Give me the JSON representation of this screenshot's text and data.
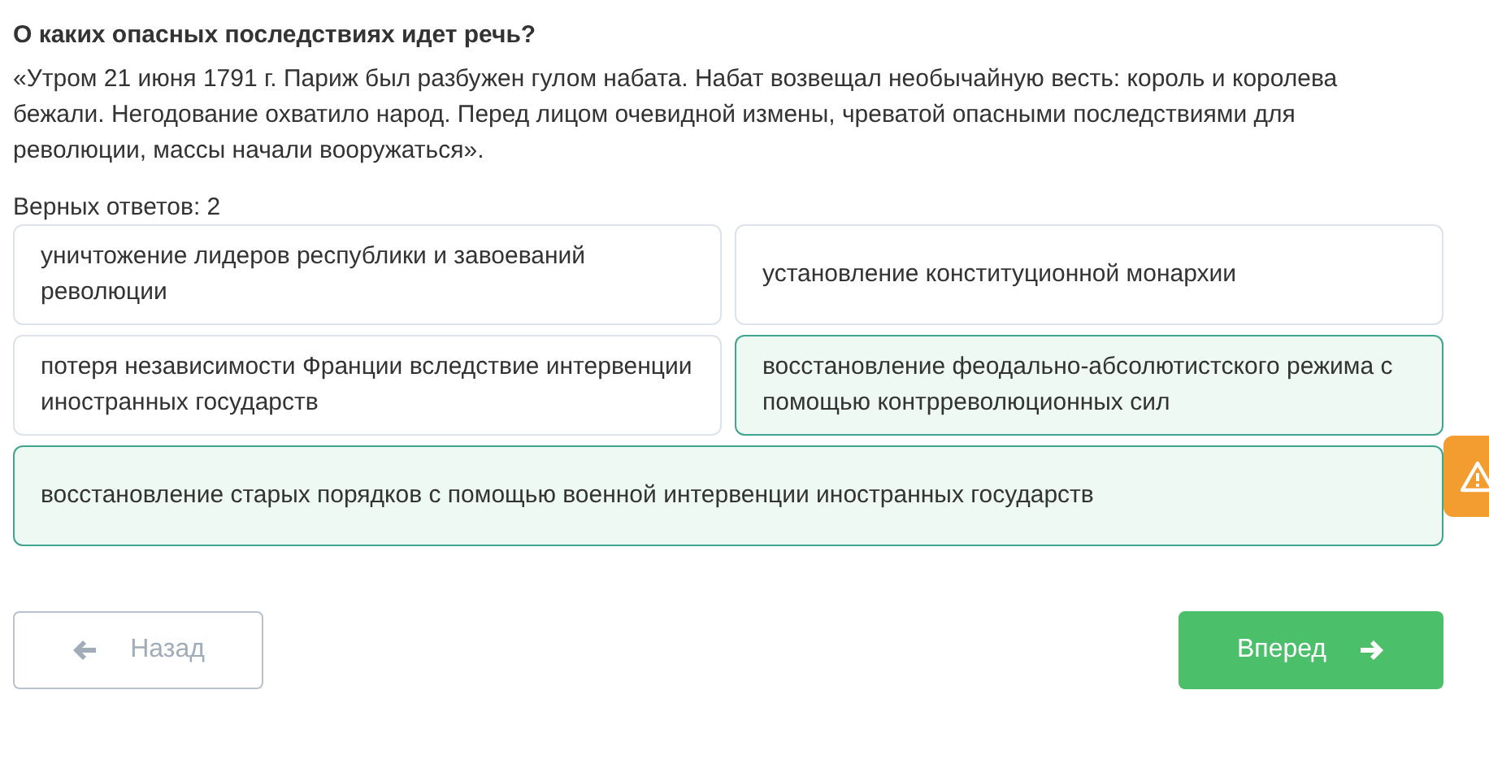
{
  "question": {
    "title": "О каких опасных последствиях идет речь?",
    "text": "«Утром 21 июня 1791 г. Париж был разбужен гулом набата. Набат возвещал необычайную весть: король и королева бежали. Негодование охватило народ. Перед лицом очевидной измены, чреватой опасными последствиями для революции, массы начали вооружаться».",
    "answers_count": "Верных ответов: 2"
  },
  "options": [
    {
      "text": "уничтожение лидеров республики и завоеваний революции",
      "selected": false
    },
    {
      "text": "установление конституционной монархии",
      "selected": false
    },
    {
      "text": "потеря независимости Франции вследствие интервенции иностранных государств",
      "selected": false
    },
    {
      "text": "восстановление феодально-абсолютистского режима с помощью контрреволюционных сил",
      "selected": true
    },
    {
      "text": "восстановление старых порядков с помощью военной интервенции иностранных государств",
      "selected": true
    }
  ],
  "nav": {
    "back": {
      "label": "Назад",
      "disabled": true
    },
    "next": {
      "label": "Вперед",
      "disabled": false
    }
  }
}
